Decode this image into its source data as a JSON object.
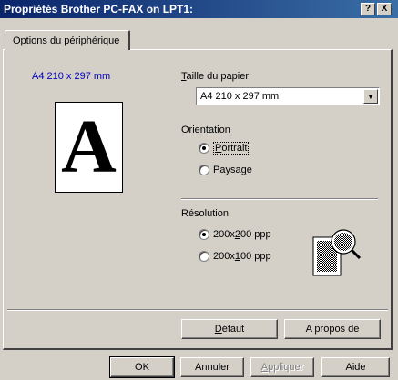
{
  "window": {
    "title": "Propriétés Brother PC-FAX on LPT1:",
    "help_btn": "?",
    "close_btn": "X"
  },
  "tab": {
    "label": "Options du périphérique"
  },
  "preview": {
    "size_label": "A4 210 x 297 mm",
    "letter": "A"
  },
  "paper": {
    "label_first": "T",
    "label_rest": "aille du papier",
    "selected": "A4 210 x 297 mm"
  },
  "orientation": {
    "label": "Orientation",
    "portrait": {
      "pre": "",
      "hot": "P",
      "post": "ortrait",
      "checked": true
    },
    "landscape": {
      "pre": "Paysa",
      "hot": "g",
      "post": "e",
      "checked": false
    }
  },
  "resolution": {
    "label": "Résolution",
    "opt1": {
      "pre": "200x",
      "hot": "2",
      "post": "00 ppp",
      "checked": true
    },
    "opt2": {
      "pre": "200x",
      "hot": "1",
      "post": "00 ppp",
      "checked": false
    }
  },
  "buttons": {
    "defaut_hot": "D",
    "defaut_rest": "éfaut",
    "apropos": "A propos de",
    "ok": "OK",
    "annuler": "Annuler",
    "appliquer_hot": "A",
    "appliquer_rest": "ppliquer",
    "aide": "Aide"
  }
}
